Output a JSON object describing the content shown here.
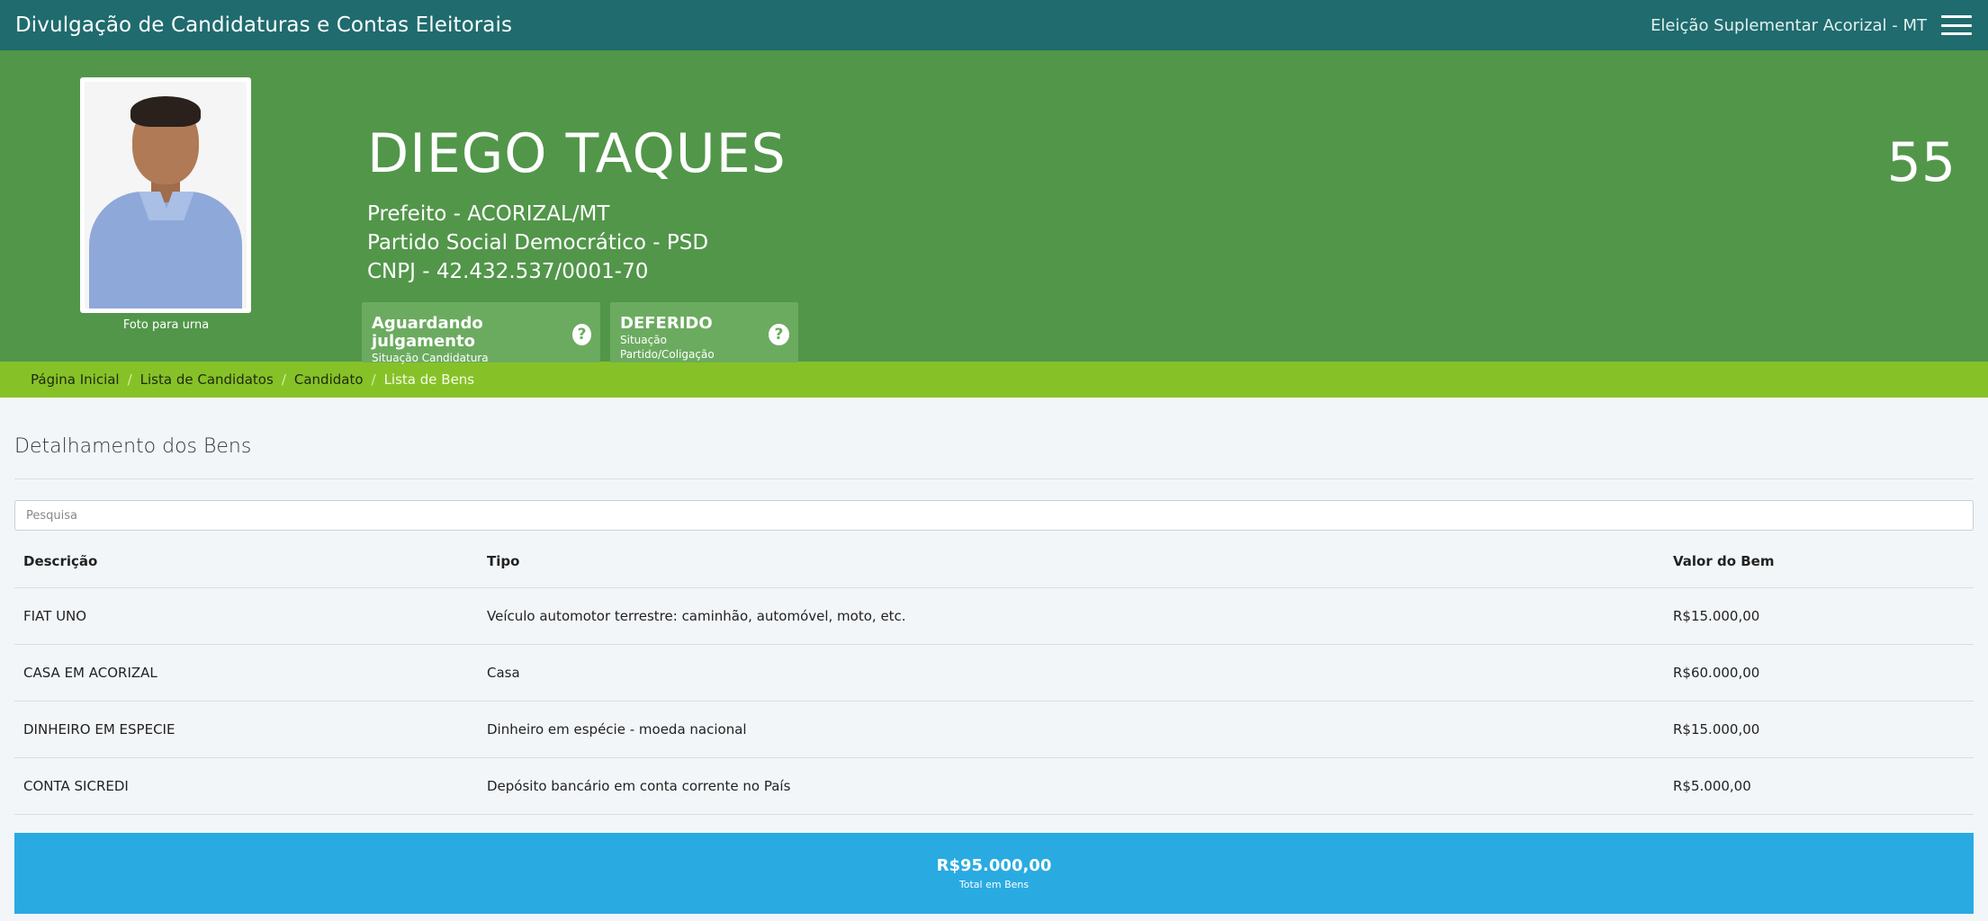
{
  "header": {
    "app_title": "Divulgação de Candidaturas e Contas Eleitorais",
    "election": "Eleição Suplementar Acorizal - MT",
    "menu_icon": "hamburger-menu-icon"
  },
  "candidate": {
    "name": "DIEGO TAQUES",
    "office": "Prefeito - ACORIZAL/MT",
    "party": "Partido Social Democrático - PSD",
    "cnpj": "CNPJ - 42.432.537/0001-70",
    "number": "55",
    "photo_caption": "Foto para urna",
    "status_badges": [
      {
        "main": "Aguardando julgamento",
        "sub": "Situação Candidatura",
        "icon": "help-icon"
      },
      {
        "main": "DEFERIDO",
        "sub": "Situação Partido/Coligação",
        "icon": "help-icon"
      }
    ]
  },
  "colors": {
    "topbar": "#1f6b6e",
    "hero": "#52964a",
    "breadcrumb": "#86c227",
    "total": "#29abe2"
  },
  "breadcrumb": {
    "items": [
      "Página Inicial",
      "Lista de Candidatos",
      "Candidato"
    ],
    "current": "Lista de Bens",
    "separator": "/"
  },
  "assets": {
    "title": "Detalhamento dos Bens",
    "search_placeholder": "Pesquisa",
    "columns": [
      "Descrição",
      "Tipo",
      "Valor do Bem"
    ],
    "rows": [
      [
        "FIAT UNO",
        "Veículo automotor terrestre: caminhão, automóvel, moto, etc.",
        "R$15.000,00"
      ],
      [
        "CASA EM ACORIZAL",
        "Casa",
        "R$60.000,00"
      ],
      [
        "DINHEIRO EM ESPECIE",
        "Dinheiro em espécie - moeda nacional",
        "R$15.000,00"
      ],
      [
        "CONTA SICREDI",
        "Depósito bancário em conta corrente no País",
        "R$5.000,00"
      ]
    ],
    "total_value": "R$95.000,00",
    "total_label": "Total em Bens"
  }
}
